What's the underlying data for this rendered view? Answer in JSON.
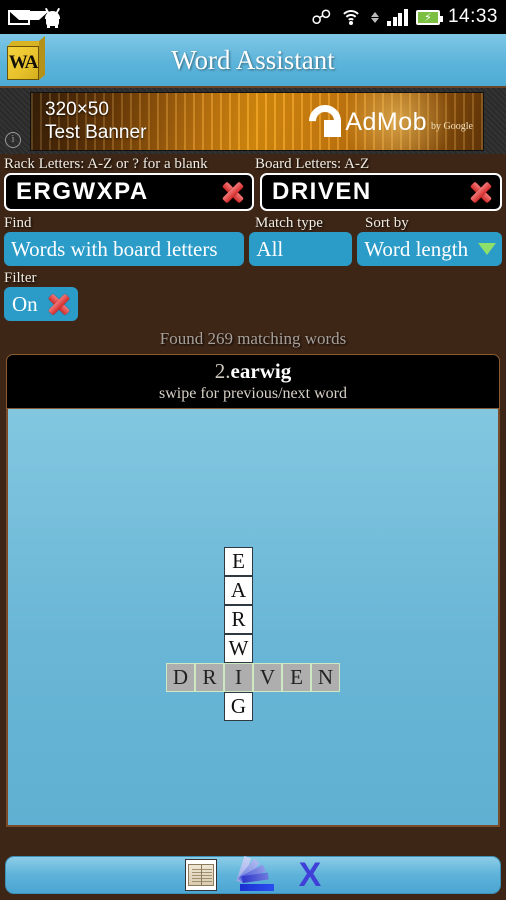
{
  "status_bar": {
    "icons": [
      "mail-icon",
      "android-icon",
      "bluetooth-icon",
      "wifi-icon",
      "signal-icon",
      "battery-charging-icon"
    ],
    "time": "14:33"
  },
  "title_bar": {
    "logo_text": "WA",
    "title": "Word Assistant"
  },
  "ad": {
    "info_glyph": "i",
    "line1": "320×50",
    "line2": "Test Banner",
    "brand": "AdMob",
    "brand_suffix": "by Google"
  },
  "form": {
    "rack": {
      "label": "Rack Letters: A-Z or ? for a blank",
      "value": "ERGWXPA",
      "clear_label": "clear-rack"
    },
    "board": {
      "label": "Board Letters: A-Z",
      "value": "DRIVEN",
      "clear_label": "clear-board"
    },
    "find": {
      "label": "Find",
      "value": "Words with board letters"
    },
    "match_type": {
      "label": "Match type",
      "value": "All"
    },
    "sort_by": {
      "label": "Sort by",
      "value": "Word length",
      "caret_color": "#8ce06a"
    },
    "filter": {
      "label": "Filter",
      "value": "On"
    }
  },
  "results": {
    "found_text": "Found 269 matching words",
    "count": 269,
    "index_label": "2.",
    "word": "earwig",
    "swipe_hint": "swipe for previous/next word"
  },
  "board_display": {
    "vertical_word": "EARWIG",
    "horizontal_word": "DRIVEN",
    "intersect_letter": "I",
    "rows": [
      [
        {
          "l": "",
          "t": "empty"
        },
        {
          "l": "",
          "t": "empty"
        },
        {
          "l": "E",
          "t": "rack"
        },
        {
          "l": "",
          "t": "empty"
        },
        {
          "l": "",
          "t": "empty"
        },
        {
          "l": "",
          "t": "empty"
        }
      ],
      [
        {
          "l": "",
          "t": "empty"
        },
        {
          "l": "",
          "t": "empty"
        },
        {
          "l": "A",
          "t": "rack"
        },
        {
          "l": "",
          "t": "empty"
        },
        {
          "l": "",
          "t": "empty"
        },
        {
          "l": "",
          "t": "empty"
        }
      ],
      [
        {
          "l": "",
          "t": "empty"
        },
        {
          "l": "",
          "t": "empty"
        },
        {
          "l": "R",
          "t": "rack"
        },
        {
          "l": "",
          "t": "empty"
        },
        {
          "l": "",
          "t": "empty"
        },
        {
          "l": "",
          "t": "empty"
        }
      ],
      [
        {
          "l": "",
          "t": "empty"
        },
        {
          "l": "",
          "t": "empty"
        },
        {
          "l": "W",
          "t": "rack"
        },
        {
          "l": "",
          "t": "empty"
        },
        {
          "l": "",
          "t": "empty"
        },
        {
          "l": "",
          "t": "empty"
        }
      ],
      [
        {
          "l": "D",
          "t": "boardl"
        },
        {
          "l": "R",
          "t": "boardl"
        },
        {
          "l": "I",
          "t": "boardl"
        },
        {
          "l": "V",
          "t": "boardl"
        },
        {
          "l": "E",
          "t": "boardl"
        },
        {
          "l": "N",
          "t": "boardl"
        }
      ],
      [
        {
          "l": "",
          "t": "empty"
        },
        {
          "l": "",
          "t": "empty"
        },
        {
          "l": "G",
          "t": "rack"
        },
        {
          "l": "",
          "t": "empty"
        },
        {
          "l": "",
          "t": "empty"
        },
        {
          "l": "",
          "t": "empty"
        }
      ]
    ]
  },
  "toolbar": {
    "items": [
      {
        "name": "dictionary-icon",
        "label": "Dictionary"
      },
      {
        "name": "fan-chart-icon",
        "label": "Statistics"
      },
      {
        "name": "close-x-icon",
        "label": "Close"
      }
    ],
    "close_glyph": "X"
  },
  "colors": {
    "accent_blue": "#2b9bc8",
    "title_blue": "#5cb4da",
    "board_blue": "#6ab6d6",
    "wood_brown": "#3e2616",
    "clear_red": "#d22b2b",
    "caret_green": "#8ce06a"
  }
}
